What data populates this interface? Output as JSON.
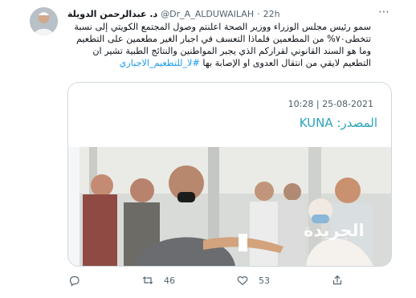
{
  "author": {
    "name": "د. عبدالرحمن الدويلة",
    "handle": "@Dr_A_ALDUWAILAH",
    "time": "22h"
  },
  "tweet": {
    "text": "سمو رئيس مجلس الوزراء ووزير الصحة اعلنتم وصول المجتمع الكويتي إلى نسبة تتخطى٧٠% من المطعمين فلماذا التعسف في اجبار الغير مطعمين على التطعيم وما هو السند القانوني لقراركم الذي يجبر المواطنين والنتائج الطبية تشير ان التطعيم لايقي من انتقال العدوى او الإصابة بها",
    "hashtag": "#لا_للتطعيم_الاجباري"
  },
  "media": {
    "timestamp": "10:28 | 25-08-2021",
    "source_label": "المصدر:",
    "source": "KUNA",
    "watermark": "الجريدة"
  },
  "actions": {
    "retweets": "46",
    "likes": "53"
  },
  "icons": {
    "more": "more-icon",
    "reply": "reply-icon",
    "retweet": "retweet-icon",
    "like": "heart-icon",
    "share": "share-icon"
  },
  "colors": {
    "accent": "#1d9bf0",
    "muted": "#536471",
    "source": "#2aa3b8"
  }
}
